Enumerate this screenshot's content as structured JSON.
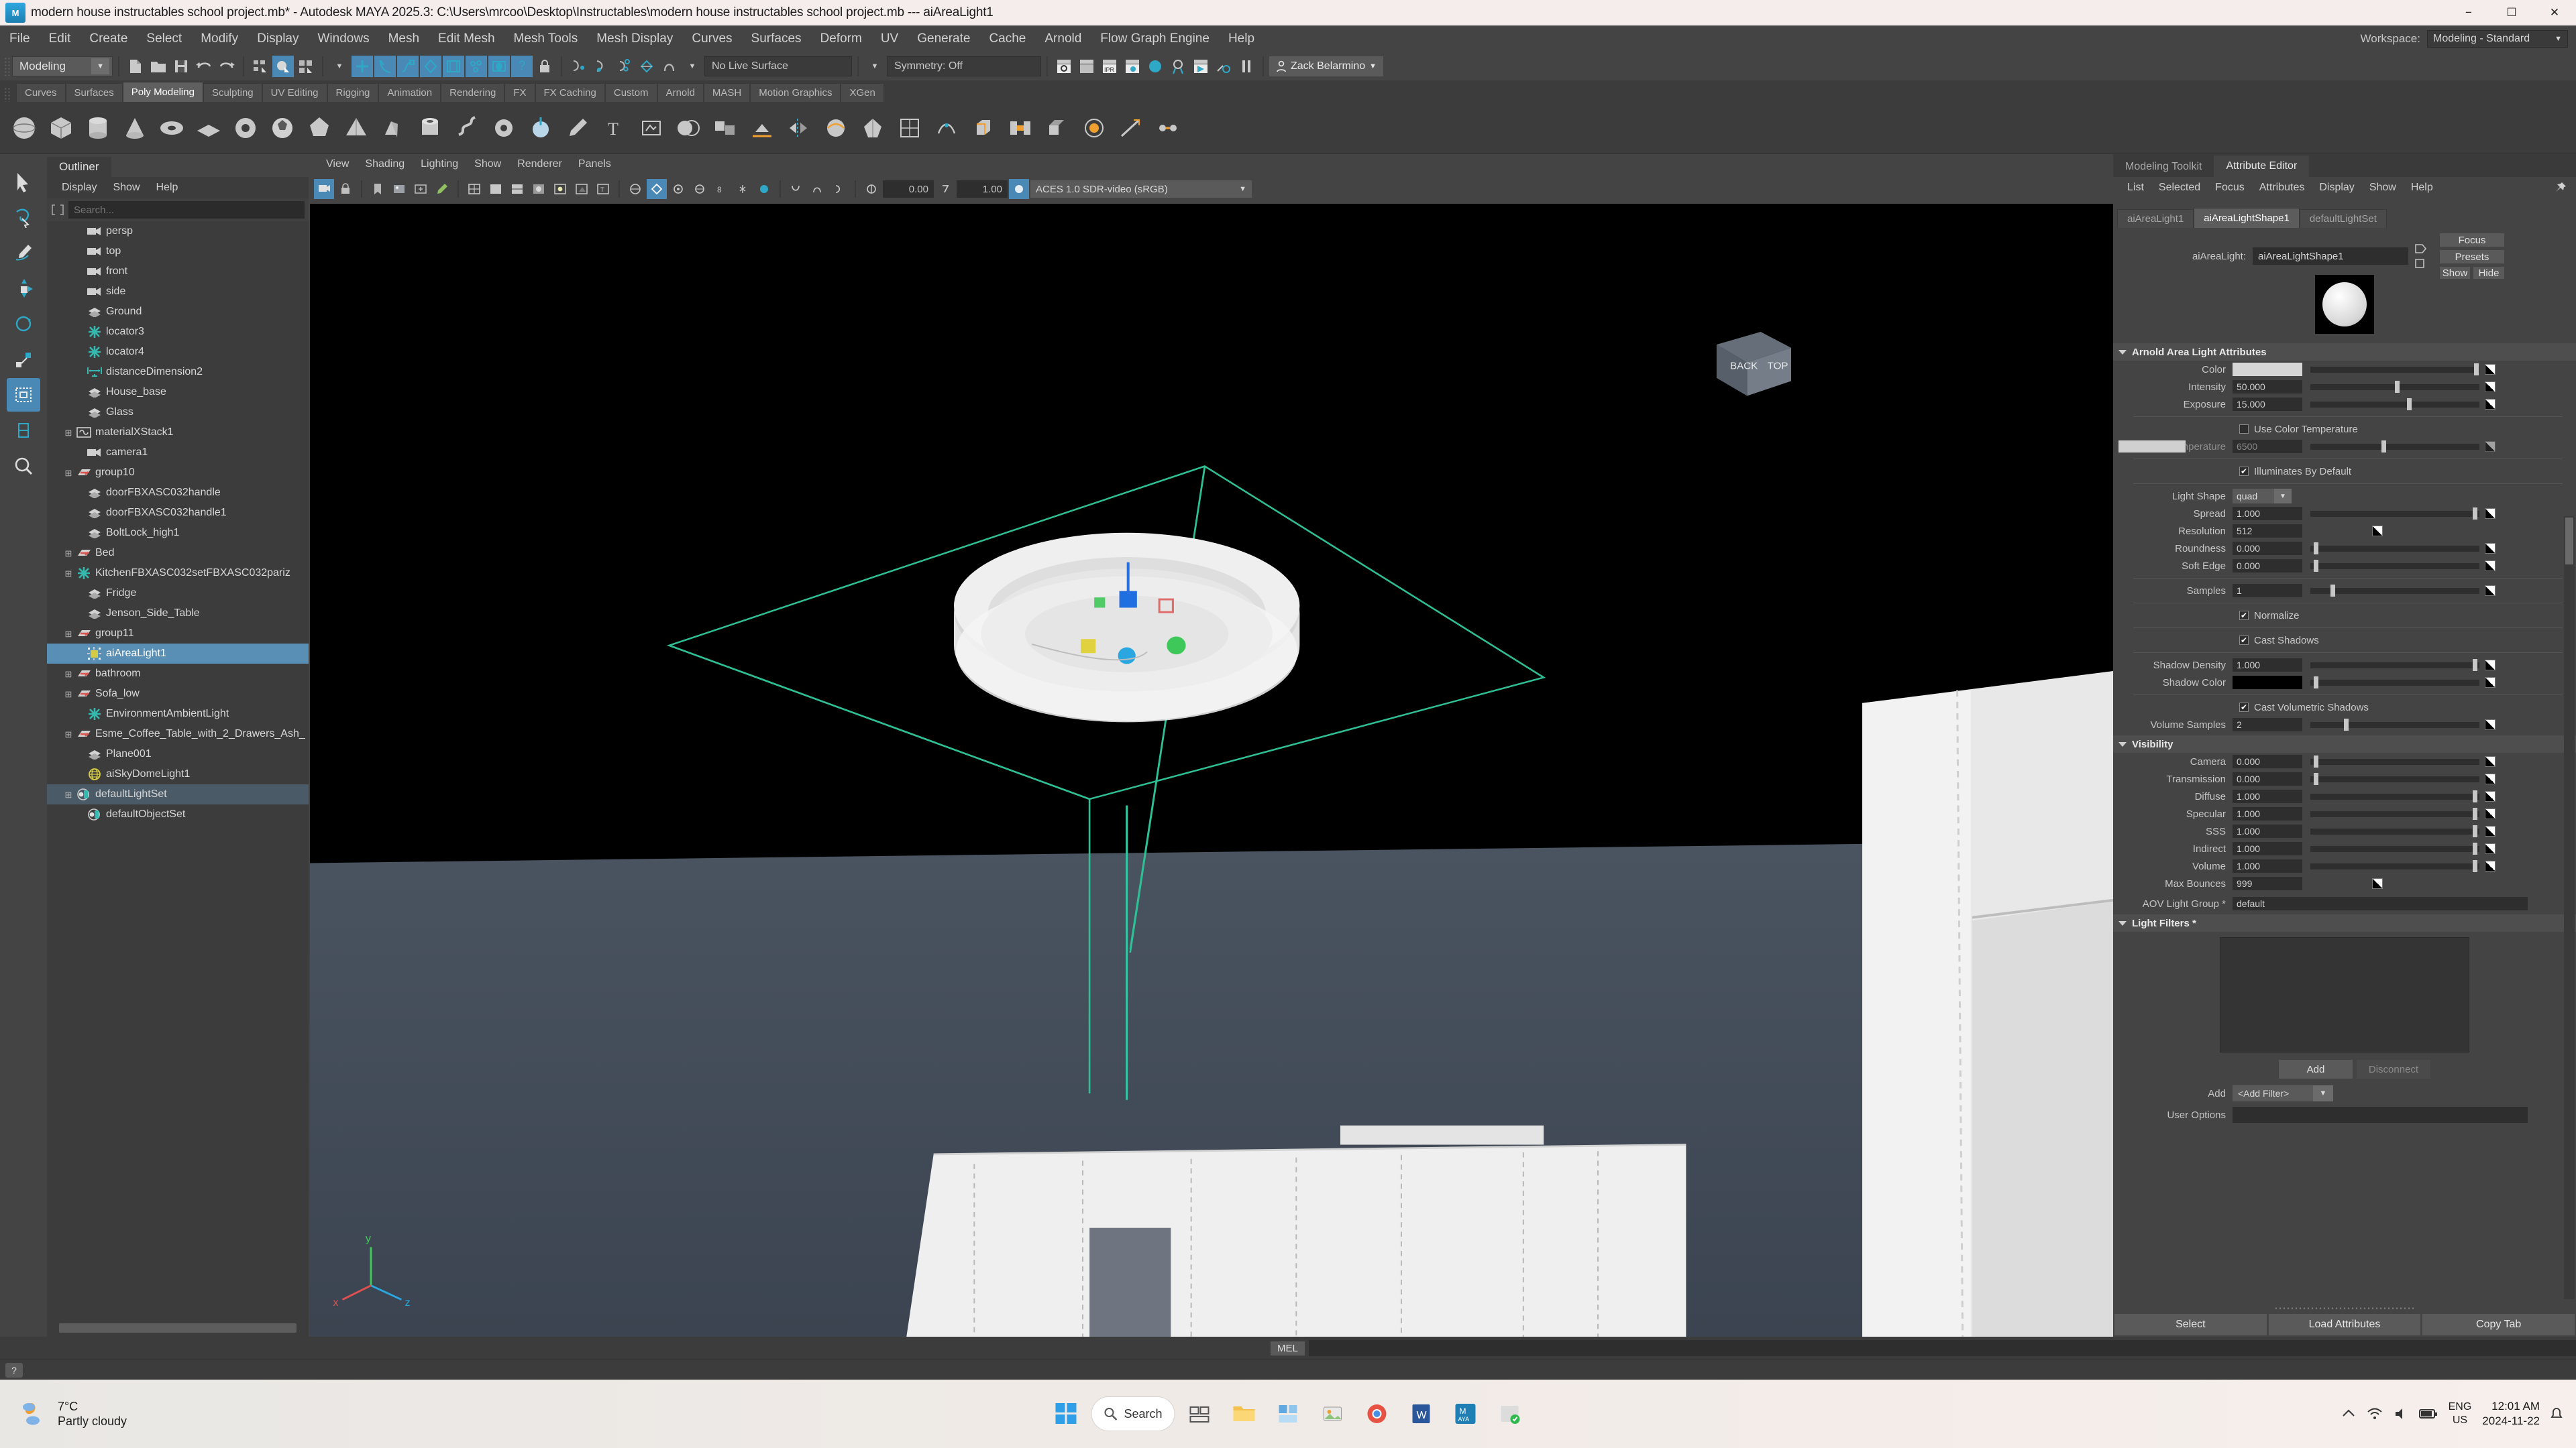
{
  "window": {
    "title": "modern house instructables school project.mb* - Autodesk MAYA 2025.3: C:\\Users\\mrcoo\\Desktop\\Instructables\\modern house instructables school project.mb   ---   aiAreaLight1",
    "minimize": "−",
    "maximize": "☐",
    "close": "✕",
    "app_icon_label": "M"
  },
  "menubar": {
    "items": [
      "File",
      "Edit",
      "Create",
      "Select",
      "Modify",
      "Display",
      "Windows",
      "Mesh",
      "Edit Mesh",
      "Mesh Tools",
      "Mesh Display",
      "Curves",
      "Surfaces",
      "Deform",
      "UV",
      "Generate",
      "Cache",
      "Arnold",
      "Flow Graph Engine",
      "Help"
    ],
    "workspace_label": "Workspace:",
    "workspace_value": "Modeling - Standard"
  },
  "statusbar": {
    "mode": "Modeling",
    "live_surface": "No Live Surface",
    "symmetry": "Symmetry: Off",
    "user": "Zack Belarmino"
  },
  "shelf": {
    "tabs": [
      "Curves",
      "Surfaces",
      "Poly Modeling",
      "Sculpting",
      "UV Editing",
      "Rigging",
      "Animation",
      "Rendering",
      "FX",
      "FX Caching",
      "Custom",
      "Arnold",
      "MASH",
      "Motion Graphics",
      "XGen"
    ],
    "active_tab": "Poly Modeling"
  },
  "outliner": {
    "tab": "Outliner",
    "menu": [
      "Display",
      "Show",
      "Help"
    ],
    "search_placeholder": "Search...",
    "items": [
      {
        "label": "persp",
        "icon": "camera-icon",
        "indent": 1,
        "expand": false,
        "state": "normal"
      },
      {
        "label": "top",
        "icon": "camera-icon",
        "indent": 1,
        "expand": false,
        "state": "normal"
      },
      {
        "label": "front",
        "icon": "camera-icon",
        "indent": 1,
        "expand": false,
        "state": "normal"
      },
      {
        "label": "side",
        "icon": "camera-icon",
        "indent": 1,
        "expand": false,
        "state": "normal"
      },
      {
        "label": "Ground",
        "icon": "mesh-icon",
        "indent": 1,
        "expand": false,
        "state": "normal"
      },
      {
        "label": "locator3",
        "icon": "locator-icon",
        "indent": 1,
        "expand": false,
        "state": "normal"
      },
      {
        "label": "locator4",
        "icon": "locator-icon",
        "indent": 1,
        "expand": false,
        "state": "normal"
      },
      {
        "label": "distanceDimension2",
        "icon": "distance-icon",
        "indent": 1,
        "expand": false,
        "state": "normal"
      },
      {
        "label": "House_base",
        "icon": "mesh-icon",
        "indent": 1,
        "expand": false,
        "state": "normal"
      },
      {
        "label": "Glass",
        "icon": "mesh-icon",
        "indent": 1,
        "expand": false,
        "state": "normal"
      },
      {
        "label": "materialXStack1",
        "icon": "materialx-icon",
        "indent": 0,
        "expand": true,
        "state": "normal"
      },
      {
        "label": "camera1",
        "icon": "camera-icon",
        "indent": 1,
        "expand": false,
        "state": "normal"
      },
      {
        "label": "group10",
        "icon": "group-icon",
        "indent": 0,
        "expand": true,
        "state": "normal"
      },
      {
        "label": "doorFBXASC032handle",
        "icon": "mesh-icon",
        "indent": 1,
        "expand": false,
        "state": "normal"
      },
      {
        "label": "doorFBXASC032handle1",
        "icon": "mesh-icon",
        "indent": 1,
        "expand": false,
        "state": "normal"
      },
      {
        "label": "BoltLock_high1",
        "icon": "mesh-icon",
        "indent": 1,
        "expand": false,
        "state": "normal"
      },
      {
        "label": "Bed",
        "icon": "group-icon",
        "indent": 0,
        "expand": true,
        "state": "normal"
      },
      {
        "label": "KitchenFBXASC032setFBXASC032pariz",
        "icon": "locator-icon",
        "indent": 0,
        "expand": true,
        "state": "normal"
      },
      {
        "label": "Fridge",
        "icon": "mesh-icon",
        "indent": 1,
        "expand": false,
        "state": "normal"
      },
      {
        "label": "Jenson_Side_Table",
        "icon": "mesh-icon",
        "indent": 1,
        "expand": false,
        "state": "normal"
      },
      {
        "label": "group11",
        "icon": "group-icon",
        "indent": 0,
        "expand": true,
        "state": "normal"
      },
      {
        "label": "aiAreaLight1",
        "icon": "arealight-icon",
        "indent": 1,
        "expand": false,
        "state": "selected"
      },
      {
        "label": "bathroom",
        "icon": "group-icon",
        "indent": 0,
        "expand": true,
        "state": "normal"
      },
      {
        "label": "Sofa_low",
        "icon": "group-icon",
        "indent": 0,
        "expand": true,
        "state": "normal"
      },
      {
        "label": "EnvironmentAmbientLight",
        "icon": "locator-icon",
        "indent": 1,
        "expand": false,
        "state": "normal"
      },
      {
        "label": "Esme_Coffee_Table_with_2_Drawers_Ash_",
        "icon": "group-icon",
        "indent": 0,
        "expand": true,
        "state": "normal"
      },
      {
        "label": "Plane001",
        "icon": "mesh-icon",
        "indent": 1,
        "expand": false,
        "state": "normal"
      },
      {
        "label": "aiSkyDomeLight1",
        "icon": "skydome-icon",
        "indent": 1,
        "expand": false,
        "state": "normal"
      },
      {
        "label": "defaultLightSet",
        "icon": "set-icon",
        "indent": 0,
        "expand": true,
        "state": "highlight"
      },
      {
        "label": "defaultObjectSet",
        "icon": "set-icon",
        "indent": 1,
        "expand": false,
        "state": "normal"
      }
    ]
  },
  "viewport": {
    "menu": [
      "View",
      "Shading",
      "Lighting",
      "Show",
      "Renderer",
      "Panels"
    ],
    "near_clip": "0.00",
    "far_clip": "1.00",
    "color_space": "ACES 1.0 SDR-video (sRGB)",
    "axis_labels": {
      "x": "x",
      "y": "y",
      "z": "z"
    },
    "viewcube_label": "BACK"
  },
  "attribute_editor": {
    "panel_tabs": [
      "Modeling Toolkit",
      "Attribute Editor"
    ],
    "active_panel_tab": "Attribute Editor",
    "menu": [
      "List",
      "Selected",
      "Focus",
      "Attributes",
      "Display",
      "Show",
      "Help"
    ],
    "node_tabs": [
      "aiAreaLight1",
      "aiAreaLightShape1",
      "defaultLightSet"
    ],
    "active_node_tab": "aiAreaLightShape1",
    "node_field_label": "aiAreaLight:",
    "node_field_value": "aiAreaLightShape1",
    "side_buttons": {
      "focus": "Focus",
      "presets": "Presets",
      "show": "Show",
      "hide": "Hide"
    },
    "sections": {
      "arnold": {
        "title": "Arnold Area Light Attributes",
        "rows": [
          {
            "label": "Color",
            "type": "color",
            "value": "#d6d6d6",
            "slider": 0.97
          },
          {
            "label": "Intensity",
            "type": "number",
            "value": "50.000",
            "slider": 0.5
          },
          {
            "label": "Exposure",
            "type": "number",
            "value": "15.000",
            "slider": 0.57
          },
          {
            "label": "Use Color Temperature",
            "type": "check",
            "checked": false
          },
          {
            "label": "Temperature",
            "type": "number",
            "value": "6500",
            "slider": 0.42,
            "disabled": true,
            "swatch": "#d0d0d0"
          },
          {
            "label": "Illuminates By Default",
            "type": "check",
            "checked": true
          },
          {
            "label": "Light Shape",
            "type": "dropdown",
            "value": "quad"
          },
          {
            "label": "Spread",
            "type": "number",
            "value": "1.000",
            "slider": 0.96
          },
          {
            "label": "Resolution",
            "type": "number",
            "value": "512",
            "slider": null
          },
          {
            "label": "Roundness",
            "type": "number",
            "value": "0.000",
            "slider": 0.02
          },
          {
            "label": "Soft Edge",
            "type": "number",
            "value": "0.000",
            "slider": 0.02
          },
          {
            "label": "Samples",
            "type": "number",
            "value": "1",
            "slider": 0.12
          },
          {
            "label": "Normalize",
            "type": "check",
            "checked": true
          },
          {
            "label": "Cast Shadows",
            "type": "check",
            "checked": true
          },
          {
            "label": "Shadow Density",
            "type": "number",
            "value": "1.000",
            "slider": 0.96
          },
          {
            "label": "Shadow Color",
            "type": "color",
            "value": "#000000",
            "slider": 0.02
          },
          {
            "label": "Cast Volumetric Shadows",
            "type": "check",
            "checked": true
          },
          {
            "label": "Volume Samples",
            "type": "number",
            "value": "2",
            "slider": 0.2
          }
        ]
      },
      "visibility": {
        "title": "Visibility",
        "rows": [
          {
            "label": "Camera",
            "type": "number",
            "value": "0.000",
            "slider": 0.02
          },
          {
            "label": "Transmission",
            "type": "number",
            "value": "0.000",
            "slider": 0.02
          },
          {
            "label": "Diffuse",
            "type": "number",
            "value": "1.000",
            "slider": 0.96
          },
          {
            "label": "Specular",
            "type": "number",
            "value": "1.000",
            "slider": 0.96
          },
          {
            "label": "SSS",
            "type": "number",
            "value": "1.000",
            "slider": 0.96
          },
          {
            "label": "Indirect",
            "type": "number",
            "value": "1.000",
            "slider": 0.96
          },
          {
            "label": "Volume",
            "type": "number",
            "value": "1.000",
            "slider": 0.96
          },
          {
            "label": "Max Bounces",
            "type": "number",
            "value": "999",
            "slider": null
          }
        ],
        "aov_label": "AOV Light Group *",
        "aov_value": "default"
      },
      "light_filters": {
        "title": "Light Filters *",
        "add_button": "Add",
        "disconnect_button": "Disconnect",
        "add_label": "Add",
        "add_filter_value": "<Add Filter>",
        "user_options_label": "User Options",
        "user_options_value": ""
      }
    },
    "bottom_buttons": [
      "Select",
      "Load Attributes",
      "Copy Tab"
    ]
  },
  "command_line": {
    "language": "MEL",
    "input_value": ""
  },
  "taskbar": {
    "weather_temp": "7°C",
    "weather_desc": "Partly cloudy",
    "search_placeholder": "Search",
    "time": "12:01 AM",
    "date": "2024-11-22",
    "language": "ENG",
    "region": "US"
  },
  "colors": {
    "accent_blue": "#4a88b5",
    "panel_bg": "#444444",
    "dark_field": "#2e2e2e",
    "selection": "#5a8fb5",
    "light_green_wire": "#36c29a"
  }
}
